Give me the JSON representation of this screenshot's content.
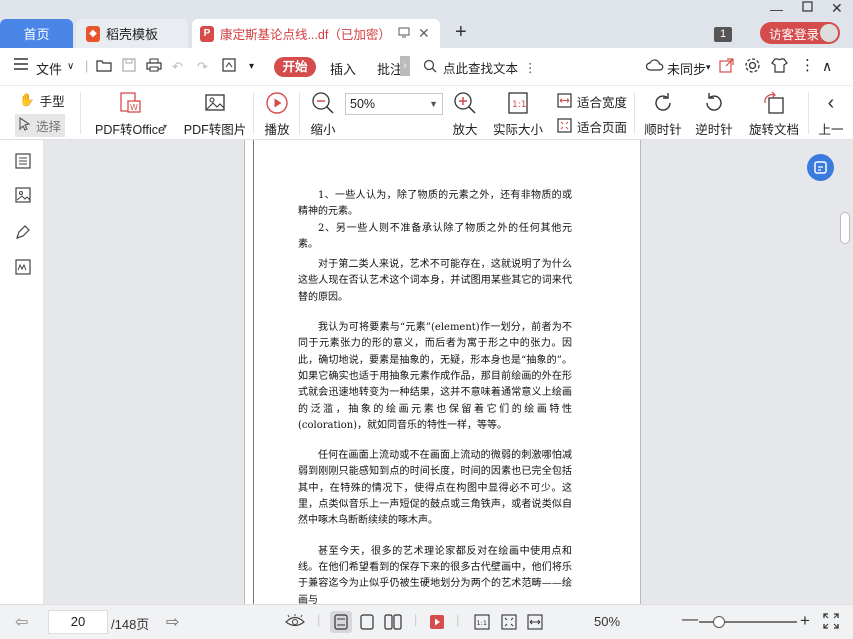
{
  "tabs": {
    "home": "首页",
    "template": "稻壳模板",
    "document": "康定斯基论点线...df（已加密）",
    "new_tab": "+"
  },
  "window": {
    "badge": "1",
    "visitor_login": "访客登录"
  },
  "menu": {
    "file": "文件",
    "start": "开始",
    "insert": "插入",
    "annotate": "批注",
    "search": "点此查找文本",
    "sync": "未同步"
  },
  "ribbon": {
    "hand": "手型",
    "select": "选择",
    "pdf_to_office": "PDF转Office",
    "pdf_to_image": "PDF转图片",
    "play": "播放",
    "zoom_out": "缩小",
    "zoom_value": "50%",
    "zoom_in": "放大",
    "actual_size": "实际大小",
    "fit_width": "适合宽度",
    "fit_page": "适合页面",
    "rotate_cw": "顺时针",
    "rotate_ccw": "逆时针",
    "rotate_doc": "旋转文档",
    "prev": "上一"
  },
  "document": {
    "paragraphs": [
      "1、一些人认为，除了物质的元素之外，还有非物质的或精神的元素。",
      "2、另一些人则不准备承认除了物质之外的任何其他元素。",
      "对于第二类人来说，艺术不可能存在，这就说明了为什么这些人现在否认艺术这个词本身，并试图用某些其它的词来代替的原因。",
      "我认为可将要素与“元素”(element)作一划分，前者为不同于元素张力的形的意义，而后者为寓于形之中的张力。因此，确切地说，要素是抽象的，无疑，形本身也是“抽象的”。如果它确实也适于用抽象元素作成作品，那目前绘画的外在形式就会迅速地转变为一种结果，这并不意味着通常意义上绘画的泛滥，抽象的绘画元素也保留着它们的绘画特性(coloration)，就如同音乐的特性一样，等等。",
      "任何在画面上流动或不在画面上流动的微弱的刺激哪怕减弱到刚刚只能感知到点的时间长度，时间的因素也已完全包括其中，在特殊的情况下，使得点在构图中显得必不可少。这里，点类似音乐上一声短促的鼓点或三角铁声，或者说类似自然中啄木鸟断断续续的啄木声。",
      "甚至今天，很多的艺术理论家都反对在绘画中使用点和线。在他们希望看到的保存下来的很多古代壁画中，他们将乐于兼容迄今为止似乎仍被生硬地划分为两个的艺术范畴——绘画与"
    ]
  },
  "status": {
    "current_page": "20",
    "total_pages": "/148页",
    "zoom": "50%"
  }
}
